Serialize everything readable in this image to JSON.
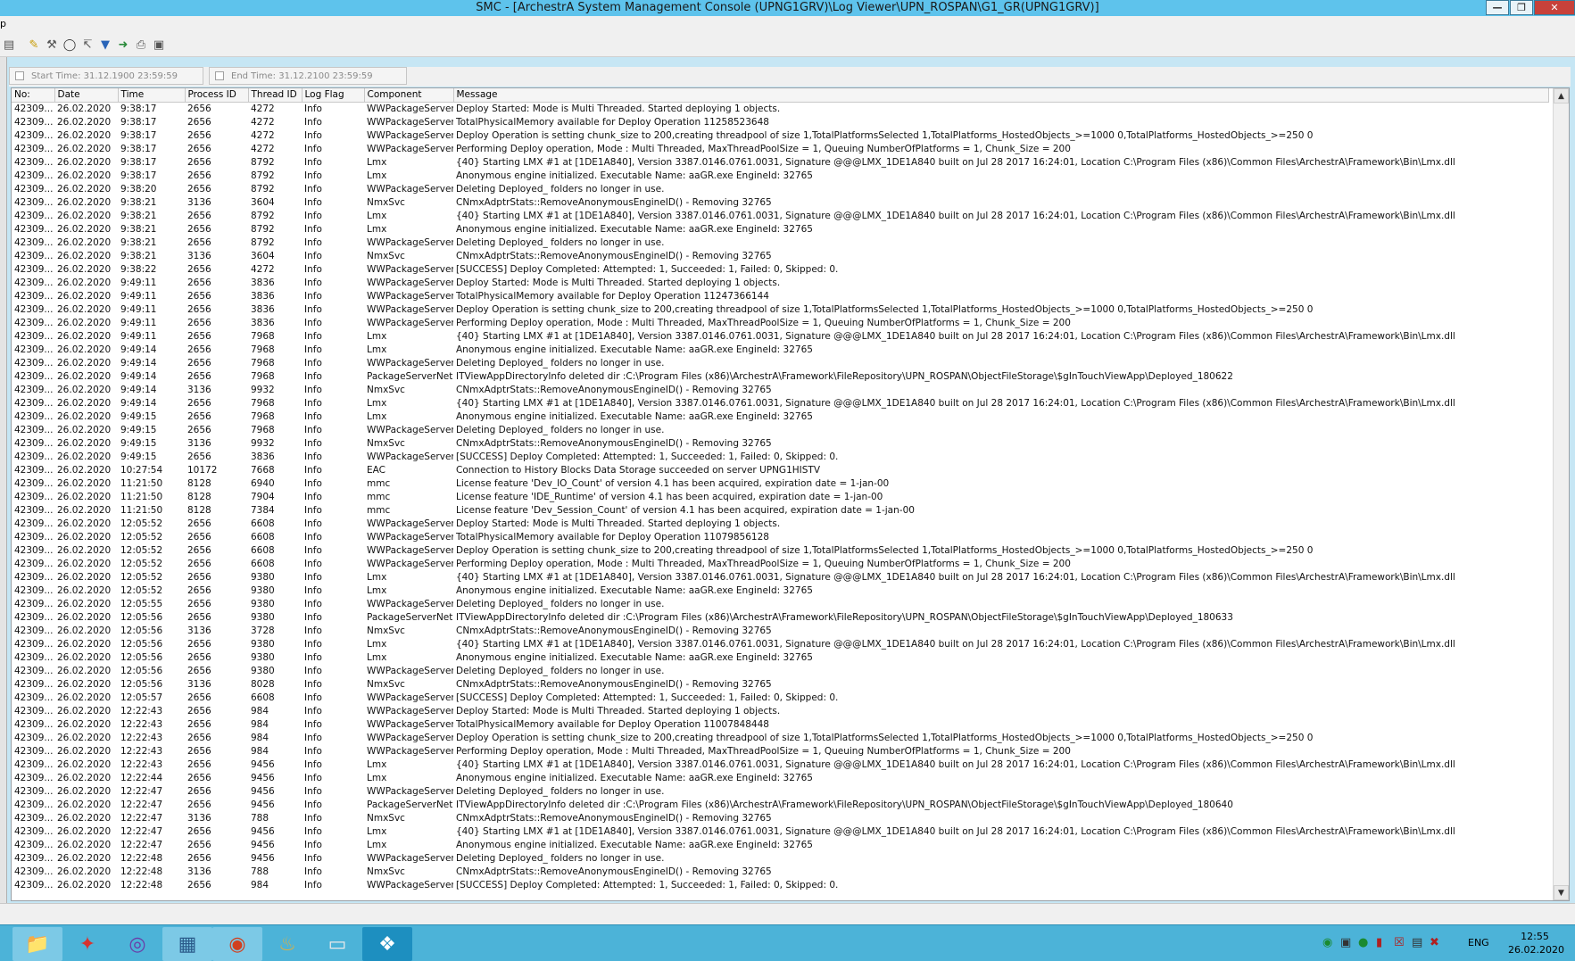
{
  "window": {
    "title": "SMC - [ArchestrA System Management Console (UPNG1GRV)\\Log Viewer\\UPN_ROSPAN\\G1_GR(UPNG1GRV)]"
  },
  "menubar": {
    "visible_fragment": "p"
  },
  "filter": {
    "start_time_label": "Start Time: 31.12.1900   23:59:59",
    "end_time_label": "End Time: 31.12.2100   23:59:59"
  },
  "grid": {
    "columns": [
      "No:",
      "Date",
      "Time",
      "Process ID",
      "Thread ID",
      "Log Flag",
      "Component",
      "Message"
    ],
    "selected_row_index": 59,
    "rows": [
      [
        "42309...",
        "26.02.2020",
        "9:38:17",
        "2656",
        "4272",
        "Info",
        "WWPackageServer",
        "Deploy Started: Mode is Multi Threaded. Started deploying  1 objects."
      ],
      [
        "42309...",
        "26.02.2020",
        "9:38:17",
        "2656",
        "4272",
        "Info",
        "WWPackageServer",
        "TotalPhysicalMemory available for Deploy Operation 11258523648"
      ],
      [
        "42309...",
        "26.02.2020",
        "9:38:17",
        "2656",
        "4272",
        "Info",
        "WWPackageServer",
        "Deploy Operation is setting chunk_size to 200,creating threadpool of size 1,TotalPlatformsSelected 1,TotalPlatforms_HostedObjects_>=1000  0,TotalPlatforms_HostedObjects_>=250  0"
      ],
      [
        "42309...",
        "26.02.2020",
        "9:38:17",
        "2656",
        "4272",
        "Info",
        "WWPackageServer",
        "Performing Deploy operation, Mode : Multi Threaded, MaxThreadPoolSize = 1, Queuing NumberOfPlatforms = 1, Chunk_Size = 200"
      ],
      [
        "42309...",
        "26.02.2020",
        "9:38:17",
        "2656",
        "8792",
        "Info",
        "Lmx",
        "{40} Starting LMX #1 at [1DE1A840], Version 3387.0146.0761.0031, Signature @@@LMX_1DE1A840 built on Jul 28 2017 16:24:01, Location C:\\Program Files (x86)\\Common Files\\ArchestrA\\Framework\\Bin\\Lmx.dll"
      ],
      [
        "42309...",
        "26.02.2020",
        "9:38:17",
        "2656",
        "8792",
        "Info",
        "Lmx",
        "Anonymous engine initialized.  Executable Name: aaGR.exe EngineId: 32765"
      ],
      [
        "42309...",
        "26.02.2020",
        "9:38:20",
        "2656",
        "8792",
        "Info",
        "WWPackageServer",
        "Deleting Deployed_ folders no longer in use."
      ],
      [
        "42309...",
        "26.02.2020",
        "9:38:21",
        "3136",
        "3604",
        "Info",
        "NmxSvc",
        "CNmxAdptrStats::RemoveAnonymousEngineID() - Removing 32765"
      ],
      [
        "42309...",
        "26.02.2020",
        "9:38:21",
        "2656",
        "8792",
        "Info",
        "Lmx",
        "{40} Starting LMX #1 at [1DE1A840], Version 3387.0146.0761.0031, Signature @@@LMX_1DE1A840 built on Jul 28 2017 16:24:01, Location C:\\Program Files (x86)\\Common Files\\ArchestrA\\Framework\\Bin\\Lmx.dll"
      ],
      [
        "42309...",
        "26.02.2020",
        "9:38:21",
        "2656",
        "8792",
        "Info",
        "Lmx",
        "Anonymous engine initialized.  Executable Name: aaGR.exe EngineId: 32765"
      ],
      [
        "42309...",
        "26.02.2020",
        "9:38:21",
        "2656",
        "8792",
        "Info",
        "WWPackageServer",
        "Deleting Deployed_ folders no longer in use."
      ],
      [
        "42309...",
        "26.02.2020",
        "9:38:21",
        "3136",
        "3604",
        "Info",
        "NmxSvc",
        "CNmxAdptrStats::RemoveAnonymousEngineID() - Removing 32765"
      ],
      [
        "42309...",
        "26.02.2020",
        "9:38:22",
        "2656",
        "4272",
        "Info",
        "WWPackageServer",
        "[SUCCESS] Deploy Completed: Attempted: 1, Succeeded: 1, Failed: 0, Skipped: 0."
      ],
      [
        "42309...",
        "26.02.2020",
        "9:49:11",
        "2656",
        "3836",
        "Info",
        "WWPackageServer",
        "Deploy Started: Mode is Multi Threaded. Started deploying  1 objects."
      ],
      [
        "42309...",
        "26.02.2020",
        "9:49:11",
        "2656",
        "3836",
        "Info",
        "WWPackageServer",
        "TotalPhysicalMemory available for Deploy Operation 11247366144"
      ],
      [
        "42309...",
        "26.02.2020",
        "9:49:11",
        "2656",
        "3836",
        "Info",
        "WWPackageServer",
        "Deploy Operation is setting chunk_size to 200,creating threadpool of size 1,TotalPlatformsSelected 1,TotalPlatforms_HostedObjects_>=1000  0,TotalPlatforms_HostedObjects_>=250  0"
      ],
      [
        "42309...",
        "26.02.2020",
        "9:49:11",
        "2656",
        "3836",
        "Info",
        "WWPackageServer",
        "Performing Deploy operation, Mode : Multi Threaded, MaxThreadPoolSize = 1, Queuing NumberOfPlatforms = 1, Chunk_Size = 200"
      ],
      [
        "42309...",
        "26.02.2020",
        "9:49:11",
        "2656",
        "7968",
        "Info",
        "Lmx",
        "{40} Starting LMX #1 at [1DE1A840], Version 3387.0146.0761.0031, Signature @@@LMX_1DE1A840 built on Jul 28 2017 16:24:01, Location C:\\Program Files (x86)\\Common Files\\ArchestrA\\Framework\\Bin\\Lmx.dll"
      ],
      [
        "42309...",
        "26.02.2020",
        "9:49:14",
        "2656",
        "7968",
        "Info",
        "Lmx",
        "Anonymous engine initialized.  Executable Name: aaGR.exe EngineId: 32765"
      ],
      [
        "42309...",
        "26.02.2020",
        "9:49:14",
        "2656",
        "7968",
        "Info",
        "WWPackageServer",
        "Deleting Deployed_ folders no longer in use."
      ],
      [
        "42309...",
        "26.02.2020",
        "9:49:14",
        "2656",
        "7968",
        "Info",
        "PackageServerNet",
        "ITViewAppDirectoryInfo deleted dir :C:\\Program Files (x86)\\ArchestrA\\Framework\\FileRepository\\UPN_ROSPAN\\ObjectFileStorage\\$gInTouchViewApp\\Deployed_180622"
      ],
      [
        "42309...",
        "26.02.2020",
        "9:49:14",
        "3136",
        "9932",
        "Info",
        "NmxSvc",
        "CNmxAdptrStats::RemoveAnonymousEngineID() - Removing 32765"
      ],
      [
        "42309...",
        "26.02.2020",
        "9:49:14",
        "2656",
        "7968",
        "Info",
        "Lmx",
        "{40} Starting LMX #1 at [1DE1A840], Version 3387.0146.0761.0031, Signature @@@LMX_1DE1A840 built on Jul 28 2017 16:24:01, Location C:\\Program Files (x86)\\Common Files\\ArchestrA\\Framework\\Bin\\Lmx.dll"
      ],
      [
        "42309...",
        "26.02.2020",
        "9:49:15",
        "2656",
        "7968",
        "Info",
        "Lmx",
        "Anonymous engine initialized.  Executable Name: aaGR.exe EngineId: 32765"
      ],
      [
        "42309...",
        "26.02.2020",
        "9:49:15",
        "2656",
        "7968",
        "Info",
        "WWPackageServer",
        "Deleting Deployed_ folders no longer in use."
      ],
      [
        "42309...",
        "26.02.2020",
        "9:49:15",
        "3136",
        "9932",
        "Info",
        "NmxSvc",
        "CNmxAdptrStats::RemoveAnonymousEngineID() - Removing 32765"
      ],
      [
        "42309...",
        "26.02.2020",
        "9:49:15",
        "2656",
        "3836",
        "Info",
        "WWPackageServer",
        "[SUCCESS] Deploy Completed: Attempted: 1, Succeeded: 1, Failed: 0, Skipped: 0."
      ],
      [
        "42309...",
        "26.02.2020",
        "10:27:54",
        "10172",
        "7668",
        "Info",
        "EAC",
        "Connection to History Blocks Data Storage succeeded on server UPNG1HISTV"
      ],
      [
        "42309...",
        "26.02.2020",
        "11:21:50",
        "8128",
        "6940",
        "Info",
        "mmc",
        "License feature 'Dev_IO_Count' of version 4.1 has been acquired, expiration date = 1-jan-00"
      ],
      [
        "42309...",
        "26.02.2020",
        "11:21:50",
        "8128",
        "7904",
        "Info",
        "mmc",
        "License feature 'IDE_Runtime' of version 4.1 has been acquired, expiration date = 1-jan-00"
      ],
      [
        "42309...",
        "26.02.2020",
        "11:21:50",
        "8128",
        "7384",
        "Info",
        "mmc",
        "License feature 'Dev_Session_Count' of version 4.1 has been acquired, expiration date = 1-jan-00"
      ],
      [
        "42309...",
        "26.02.2020",
        "12:05:52",
        "2656",
        "6608",
        "Info",
        "WWPackageServer",
        "Deploy Started: Mode is Multi Threaded. Started deploying  1 objects."
      ],
      [
        "42309...",
        "26.02.2020",
        "12:05:52",
        "2656",
        "6608",
        "Info",
        "WWPackageServer",
        "TotalPhysicalMemory available for Deploy Operation 11079856128"
      ],
      [
        "42309...",
        "26.02.2020",
        "12:05:52",
        "2656",
        "6608",
        "Info",
        "WWPackageServer",
        "Deploy Operation is setting chunk_size to 200,creating threadpool of size 1,TotalPlatformsSelected 1,TotalPlatforms_HostedObjects_>=1000  0,TotalPlatforms_HostedObjects_>=250  0"
      ],
      [
        "42309...",
        "26.02.2020",
        "12:05:52",
        "2656",
        "6608",
        "Info",
        "WWPackageServer",
        "Performing Deploy operation, Mode : Multi Threaded, MaxThreadPoolSize = 1, Queuing NumberOfPlatforms = 1, Chunk_Size = 200"
      ],
      [
        "42309...",
        "26.02.2020",
        "12:05:52",
        "2656",
        "9380",
        "Info",
        "Lmx",
        "{40} Starting LMX #1 at [1DE1A840], Version 3387.0146.0761.0031, Signature @@@LMX_1DE1A840 built on Jul 28 2017 16:24:01, Location C:\\Program Files (x86)\\Common Files\\ArchestrA\\Framework\\Bin\\Lmx.dll"
      ],
      [
        "42309...",
        "26.02.2020",
        "12:05:52",
        "2656",
        "9380",
        "Info",
        "Lmx",
        "Anonymous engine initialized.  Executable Name: aaGR.exe EngineId: 32765"
      ],
      [
        "42309...",
        "26.02.2020",
        "12:05:55",
        "2656",
        "9380",
        "Info",
        "WWPackageServer",
        "Deleting Deployed_ folders no longer in use."
      ],
      [
        "42309...",
        "26.02.2020",
        "12:05:56",
        "2656",
        "9380",
        "Info",
        "PackageServerNet",
        "ITViewAppDirectoryInfo deleted dir :C:\\Program Files (x86)\\ArchestrA\\Framework\\FileRepository\\UPN_ROSPAN\\ObjectFileStorage\\$gInTouchViewApp\\Deployed_180633"
      ],
      [
        "42309...",
        "26.02.2020",
        "12:05:56",
        "3136",
        "3728",
        "Info",
        "NmxSvc",
        "CNmxAdptrStats::RemoveAnonymousEngineID() - Removing 32765"
      ],
      [
        "42309...",
        "26.02.2020",
        "12:05:56",
        "2656",
        "9380",
        "Info",
        "Lmx",
        "{40} Starting LMX #1 at [1DE1A840], Version 3387.0146.0761.0031, Signature @@@LMX_1DE1A840 built on Jul 28 2017 16:24:01, Location C:\\Program Files (x86)\\Common Files\\ArchestrA\\Framework\\Bin\\Lmx.dll"
      ],
      [
        "42309...",
        "26.02.2020",
        "12:05:56",
        "2656",
        "9380",
        "Info",
        "Lmx",
        "Anonymous engine initialized.  Executable Name: aaGR.exe EngineId: 32765"
      ],
      [
        "42309...",
        "26.02.2020",
        "12:05:56",
        "2656",
        "9380",
        "Info",
        "WWPackageServer",
        "Deleting Deployed_ folders no longer in use."
      ],
      [
        "42309...",
        "26.02.2020",
        "12:05:56",
        "3136",
        "8028",
        "Info",
        "NmxSvc",
        "CNmxAdptrStats::RemoveAnonymousEngineID() - Removing 32765"
      ],
      [
        "42309...",
        "26.02.2020",
        "12:05:57",
        "2656",
        "6608",
        "Info",
        "WWPackageServer",
        "[SUCCESS] Deploy Completed: Attempted: 1, Succeeded: 1, Failed: 0, Skipped: 0."
      ],
      [
        "42309...",
        "26.02.2020",
        "12:22:43",
        "2656",
        "984",
        "Info",
        "WWPackageServer",
        "Deploy Started: Mode is Multi Threaded. Started deploying  1 objects."
      ],
      [
        "42309...",
        "26.02.2020",
        "12:22:43",
        "2656",
        "984",
        "Info",
        "WWPackageServer",
        "TotalPhysicalMemory available for Deploy Operation 11007848448"
      ],
      [
        "42309...",
        "26.02.2020",
        "12:22:43",
        "2656",
        "984",
        "Info",
        "WWPackageServer",
        "Deploy Operation is setting chunk_size to 200,creating threadpool of size 1,TotalPlatformsSelected 1,TotalPlatforms_HostedObjects_>=1000  0,TotalPlatforms_HostedObjects_>=250  0"
      ],
      [
        "42309...",
        "26.02.2020",
        "12:22:43",
        "2656",
        "984",
        "Info",
        "WWPackageServer",
        "Performing Deploy operation, Mode : Multi Threaded, MaxThreadPoolSize = 1, Queuing NumberOfPlatforms = 1, Chunk_Size = 200"
      ],
      [
        "42309...",
        "26.02.2020",
        "12:22:43",
        "2656",
        "9456",
        "Info",
        "Lmx",
        "{40} Starting LMX #1 at [1DE1A840], Version 3387.0146.0761.0031, Signature @@@LMX_1DE1A840 built on Jul 28 2017 16:24:01, Location C:\\Program Files (x86)\\Common Files\\ArchestrA\\Framework\\Bin\\Lmx.dll"
      ],
      [
        "42309...",
        "26.02.2020",
        "12:22:44",
        "2656",
        "9456",
        "Info",
        "Lmx",
        "Anonymous engine initialized.  Executable Name: aaGR.exe EngineId: 32765"
      ],
      [
        "42309...",
        "26.02.2020",
        "12:22:47",
        "2656",
        "9456",
        "Info",
        "WWPackageServer",
        "Deleting Deployed_ folders no longer in use."
      ],
      [
        "42309...",
        "26.02.2020",
        "12:22:47",
        "2656",
        "9456",
        "Info",
        "PackageServerNet",
        "ITViewAppDirectoryInfo deleted dir :C:\\Program Files (x86)\\ArchestrA\\Framework\\FileRepository\\UPN_ROSPAN\\ObjectFileStorage\\$gInTouchViewApp\\Deployed_180640"
      ],
      [
        "42309...",
        "26.02.2020",
        "12:22:47",
        "3136",
        "788",
        "Info",
        "NmxSvc",
        "CNmxAdptrStats::RemoveAnonymousEngineID() - Removing 32765"
      ],
      [
        "42309...",
        "26.02.2020",
        "12:22:47",
        "2656",
        "9456",
        "Info",
        "Lmx",
        "{40} Starting LMX #1 at [1DE1A840], Version 3387.0146.0761.0031, Signature @@@LMX_1DE1A840 built on Jul 28 2017 16:24:01, Location C:\\Program Files (x86)\\Common Files\\ArchestrA\\Framework\\Bin\\Lmx.dll"
      ],
      [
        "42309...",
        "26.02.2020",
        "12:22:47",
        "2656",
        "9456",
        "Info",
        "Lmx",
        "Anonymous engine initialized.  Executable Name: aaGR.exe EngineId: 32765"
      ],
      [
        "42309...",
        "26.02.2020",
        "12:22:48",
        "2656",
        "9456",
        "Info",
        "WWPackageServer",
        "Deleting Deployed_ folders no longer in use."
      ],
      [
        "42309...",
        "26.02.2020",
        "12:22:48",
        "3136",
        "788",
        "Info",
        "NmxSvc",
        "CNmxAdptrStats::RemoveAnonymousEngineID() - Removing 32765"
      ],
      [
        "42309...",
        "26.02.2020",
        "12:22:48",
        "2656",
        "984",
        "Info",
        "WWPackageServer",
        "[SUCCESS] Deploy Completed: Attempted: 1, Succeeded: 1, Failed: 0, Skipped: 0."
      ]
    ]
  },
  "taskbar": {
    "apps": [
      "folder-icon",
      "archestra-ide-icon",
      "smc-icon",
      "object-viewer-icon",
      "intouch-icon",
      "paint-icon",
      "notepad-icon",
      "network-icon"
    ],
    "language": "ENG",
    "time": "12:55",
    "date": "26.02.2020"
  },
  "colors": {
    "titlebar": "#5ec3ec",
    "selection": "#3399ff",
    "taskbar": "#4cb3d8"
  }
}
